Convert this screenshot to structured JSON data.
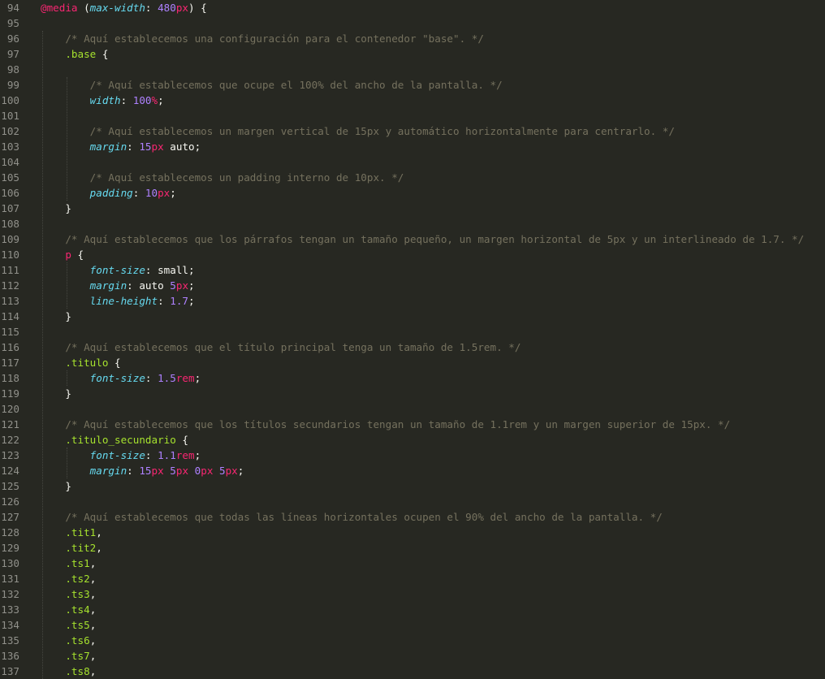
{
  "editor": {
    "line_numbers": [
      "94",
      "95",
      "96",
      "97",
      "98",
      "99",
      "100",
      "101",
      "102",
      "103",
      "104",
      "105",
      "106",
      "107",
      "108",
      "109",
      "110",
      "111",
      "112",
      "113",
      "114",
      "115",
      "116",
      "117",
      "118",
      "119",
      "120",
      "121",
      "122",
      "123",
      "124",
      "125",
      "126",
      "127",
      "128",
      "129",
      "130",
      "131",
      "132",
      "133",
      "134",
      "135",
      "136",
      "137"
    ],
    "colors": {
      "background": "#272822",
      "comment": "#75715e",
      "at_rule": "#f92672",
      "selector": "#a6e22e",
      "property": "#66d9ef",
      "number": "#ae81ff",
      "unit": "#f92672",
      "text": "#f8f8f2",
      "line_number": "#90908a"
    },
    "lines": [
      [
        [
          "at",
          "@media"
        ],
        [
          "t",
          " ("
        ],
        [
          "prop",
          "max-width"
        ],
        [
          "t",
          ": "
        ],
        [
          "num",
          "480"
        ],
        [
          "unit",
          "px"
        ],
        [
          "t",
          ") {"
        ]
      ],
      [],
      [
        [
          "t",
          "    "
        ],
        [
          "cm",
          "/* Aquí establecemos una configuración para el contenedor \"base\". */"
        ]
      ],
      [
        [
          "t",
          "    "
        ],
        [
          "sel",
          ".base"
        ],
        [
          "t",
          " {"
        ]
      ],
      [],
      [
        [
          "t",
          "        "
        ],
        [
          "cm",
          "/* Aquí establecemos que ocupe el 100% del ancho de la pantalla. */"
        ]
      ],
      [
        [
          "t",
          "        "
        ],
        [
          "prop",
          "width"
        ],
        [
          "t",
          ": "
        ],
        [
          "num",
          "100"
        ],
        [
          "unit",
          "%"
        ],
        [
          "t",
          ";"
        ]
      ],
      [],
      [
        [
          "t",
          "        "
        ],
        [
          "cm",
          "/* Aquí establecemos un margen vertical de 15px y automático horizontalmente para centrarlo. */"
        ]
      ],
      [
        [
          "t",
          "        "
        ],
        [
          "prop",
          "margin"
        ],
        [
          "t",
          ": "
        ],
        [
          "num",
          "15"
        ],
        [
          "unit",
          "px"
        ],
        [
          "t",
          " "
        ],
        [
          "kw",
          "auto"
        ],
        [
          "t",
          ";"
        ]
      ],
      [],
      [
        [
          "t",
          "        "
        ],
        [
          "cm",
          "/* Aquí establecemos un padding interno de 10px. */"
        ]
      ],
      [
        [
          "t",
          "        "
        ],
        [
          "prop",
          "padding"
        ],
        [
          "t",
          ": "
        ],
        [
          "num",
          "10"
        ],
        [
          "unit",
          "px"
        ],
        [
          "t",
          ";"
        ]
      ],
      [
        [
          "t",
          "    "
        ],
        [
          "t",
          "}"
        ]
      ],
      [],
      [
        [
          "t",
          "    "
        ],
        [
          "cm",
          "/* Aquí establecemos que los párrafos tengan un tamaño pequeño, un margen horizontal de 5px y un interlineado de 1.7. */"
        ]
      ],
      [
        [
          "t",
          "    "
        ],
        [
          "at",
          "p"
        ],
        [
          "t",
          " {"
        ]
      ],
      [
        [
          "t",
          "        "
        ],
        [
          "prop",
          "font-size"
        ],
        [
          "t",
          ": "
        ],
        [
          "kw",
          "small"
        ],
        [
          "t",
          ";"
        ]
      ],
      [
        [
          "t",
          "        "
        ],
        [
          "prop",
          "margin"
        ],
        [
          "t",
          ": "
        ],
        [
          "kw",
          "auto"
        ],
        [
          "t",
          " "
        ],
        [
          "num",
          "5"
        ],
        [
          "unit",
          "px"
        ],
        [
          "t",
          ";"
        ]
      ],
      [
        [
          "t",
          "        "
        ],
        [
          "prop",
          "line-height"
        ],
        [
          "t",
          ": "
        ],
        [
          "num",
          "1.7"
        ],
        [
          "t",
          ";"
        ]
      ],
      [
        [
          "t",
          "    "
        ],
        [
          "t",
          "}"
        ]
      ],
      [],
      [
        [
          "t",
          "    "
        ],
        [
          "cm",
          "/* Aquí establecemos que el título principal tenga un tamaño de 1.5rem. */"
        ]
      ],
      [
        [
          "t",
          "    "
        ],
        [
          "sel",
          ".titulo"
        ],
        [
          "t",
          " {"
        ]
      ],
      [
        [
          "t",
          "        "
        ],
        [
          "prop",
          "font-size"
        ],
        [
          "t",
          ": "
        ],
        [
          "num",
          "1.5"
        ],
        [
          "unit",
          "rem"
        ],
        [
          "t",
          ";"
        ]
      ],
      [
        [
          "t",
          "    "
        ],
        [
          "t",
          "}"
        ]
      ],
      [],
      [
        [
          "t",
          "    "
        ],
        [
          "cm",
          "/* Aquí establecemos que los títulos secundarios tengan un tamaño de 1.1rem y un margen superior de 15px. */"
        ]
      ],
      [
        [
          "t",
          "    "
        ],
        [
          "sel",
          ".titulo_secundario"
        ],
        [
          "t",
          " {"
        ]
      ],
      [
        [
          "t",
          "        "
        ],
        [
          "prop",
          "font-size"
        ],
        [
          "t",
          ": "
        ],
        [
          "num",
          "1.1"
        ],
        [
          "unit",
          "rem"
        ],
        [
          "t",
          ";"
        ]
      ],
      [
        [
          "t",
          "        "
        ],
        [
          "prop",
          "margin"
        ],
        [
          "t",
          ": "
        ],
        [
          "num",
          "15"
        ],
        [
          "unit",
          "px"
        ],
        [
          "t",
          " "
        ],
        [
          "num",
          "5"
        ],
        [
          "unit",
          "px"
        ],
        [
          "t",
          " "
        ],
        [
          "num",
          "0"
        ],
        [
          "unit",
          "px"
        ],
        [
          "t",
          " "
        ],
        [
          "num",
          "5"
        ],
        [
          "unit",
          "px"
        ],
        [
          "t",
          ";"
        ]
      ],
      [
        [
          "t",
          "    "
        ],
        [
          "t",
          "}"
        ]
      ],
      [],
      [
        [
          "t",
          "    "
        ],
        [
          "cm",
          "/* Aquí establecemos que todas las líneas horizontales ocupen el 90% del ancho de la pantalla. */"
        ]
      ],
      [
        [
          "t",
          "    "
        ],
        [
          "sel",
          ".tit1"
        ],
        [
          "t",
          ","
        ]
      ],
      [
        [
          "t",
          "    "
        ],
        [
          "sel",
          ".tit2"
        ],
        [
          "t",
          ","
        ]
      ],
      [
        [
          "t",
          "    "
        ],
        [
          "sel",
          ".ts1"
        ],
        [
          "t",
          ","
        ]
      ],
      [
        [
          "t",
          "    "
        ],
        [
          "sel",
          ".ts2"
        ],
        [
          "t",
          ","
        ]
      ],
      [
        [
          "t",
          "    "
        ],
        [
          "sel",
          ".ts3"
        ],
        [
          "t",
          ","
        ]
      ],
      [
        [
          "t",
          "    "
        ],
        [
          "sel",
          ".ts4"
        ],
        [
          "t",
          ","
        ]
      ],
      [
        [
          "t",
          "    "
        ],
        [
          "sel",
          ".ts5"
        ],
        [
          "t",
          ","
        ]
      ],
      [
        [
          "t",
          "    "
        ],
        [
          "sel",
          ".ts6"
        ],
        [
          "t",
          ","
        ]
      ],
      [
        [
          "t",
          "    "
        ],
        [
          "sel",
          ".ts7"
        ],
        [
          "t",
          ","
        ]
      ],
      [
        [
          "t",
          "    "
        ],
        [
          "sel",
          ".ts8"
        ],
        [
          "t",
          ","
        ]
      ]
    ]
  }
}
